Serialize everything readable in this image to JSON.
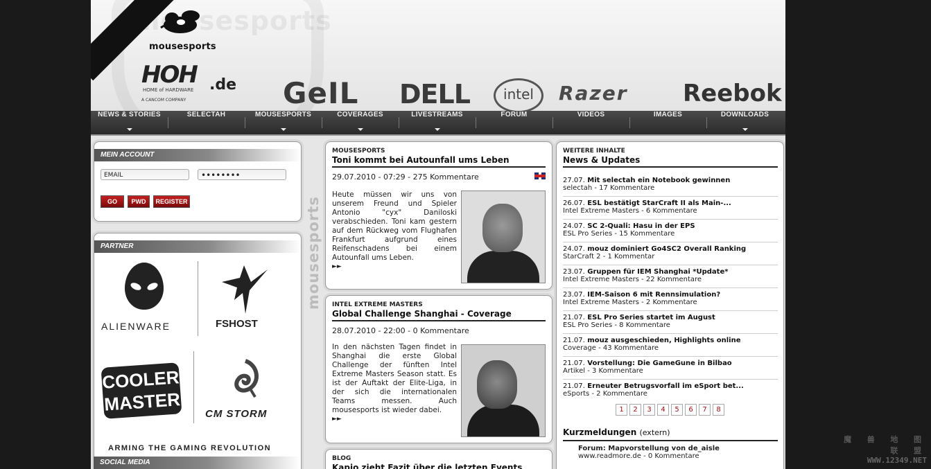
{
  "header": {
    "logo_text": "mousesports",
    "hoh_logo": "HOH",
    "hoh_domain": ".de",
    "hoh_tagline": "HOME of HARDWARE",
    "hoh_company": "A CANCOM COMPANY",
    "sponsors": [
      "GeIL",
      "DELL",
      "intel",
      "Razer",
      "Reebok"
    ]
  },
  "nav": {
    "items": [
      {
        "label": "NEWS & STORIES",
        "has_dropdown": true
      },
      {
        "label": "SELECTAH",
        "has_dropdown": false
      },
      {
        "label": "MOUSESPORTS",
        "has_dropdown": true
      },
      {
        "label": "COVERAGES",
        "has_dropdown": true
      },
      {
        "label": "LIVESTREAMS",
        "has_dropdown": true
      },
      {
        "label": "FORUM",
        "has_dropdown": false
      },
      {
        "label": "VIDEOS",
        "has_dropdown": false
      },
      {
        "label": "IMAGES",
        "has_dropdown": false
      },
      {
        "label": "DOWNLOADS",
        "has_dropdown": true
      }
    ]
  },
  "account": {
    "heading": "MEIN ACCOUNT",
    "email_placeholder": "EMAIL",
    "password_value": "••••••••",
    "buttons": {
      "go": "GO",
      "pwd": "PWD",
      "register": "REGISTER"
    }
  },
  "partner": {
    "heading": "PARTNER",
    "alienware": "ALIENWARE",
    "fshost": "FSHOST",
    "coolermaster_line1": "COOLER",
    "coolermaster_line2": "MASTER",
    "cmstorm": "CM STORM",
    "slogan": "ARMING THE GAMING REVOLUTION"
  },
  "social": {
    "heading": "SOCIAL MEDIA"
  },
  "vertical_brand": "mousesports",
  "articles": [
    {
      "category": "MOUSESPORTS",
      "title": "Toni kommt bei Autounfall ums Leben",
      "meta": "29.07.2010 - 07:29 - 275 Kommentare",
      "body": "Heute müssen wir uns von unserem Freund und Spieler Antonio \"cyx\" Daniloski verabschieden. Toni kam gestern auf dem Rückweg vom Flughafen Frankfurt aufgrund eines Reifenschadens bei einem Autounfall ums Leben.",
      "more": "►►"
    },
    {
      "category": "INTEL EXTREME MASTERS",
      "title": "Global Challenge Shanghai - Coverage",
      "meta": "28.07.2010 - 22:00 - 0 Kommentare",
      "body": "In den nächsten Tagen findet in Shanghai die erste Global Challenge der fünften Intel Extreme Masters Season statt. Es ist der Auftakt der Elite-Liga, in der sich die internationalen Teams messen. Auch mousesports ist wieder dabei.",
      "more": "►►"
    },
    {
      "category": "BLOG",
      "title": "Kapio zieht Fazit über die letzten Events"
    }
  ],
  "right": {
    "category": "WEITERE INHALTE",
    "title": "News & Updates",
    "news": [
      {
        "date": "27.07.",
        "title": "Mit selectah ein Notebook gewinnen",
        "sub": "selectah - 17 Kommentare"
      },
      {
        "date": "26.07.",
        "title": "ESL bestätigt StarCraft II als Main-...",
        "sub": "Intel Extreme Masters - 6 Kommentare"
      },
      {
        "date": "24.07.",
        "title": "SC 2-Quali: Hasu in der EPS",
        "sub": "ESL Pro Series - 15 Kommentare"
      },
      {
        "date": "24.07.",
        "title": "mouz dominiert Go4SC2 Overall Ranking",
        "sub": "StarCraft 2 - 1 Kommentar"
      },
      {
        "date": "23.07.",
        "title": "Gruppen für IEM Shanghai *Update*",
        "sub": "Intel Extreme Masters - 22 Kommentare"
      },
      {
        "date": "23.07.",
        "title": "IEM-Saison 6 mit Rennsimulation?",
        "sub": "Intel Extreme Masters - 2 Kommentare"
      },
      {
        "date": "21.07.",
        "title": "ESL Pro Series startet im August",
        "sub": "ESL Pro Series - 8 Kommentare"
      },
      {
        "date": "21.07.",
        "title": "mouz ausgeschieden, Highlights online",
        "sub": "Coverage - 43 Kommentare"
      },
      {
        "date": "21.07.",
        "title": "Vorstellung: Die GameGune in Bilbao",
        "sub": "Artikel - 3 Kommentare"
      },
      {
        "date": "21.07.",
        "title": "Erneuter Betrugsvorfall im eSport bet...",
        "sub": "eSports - 2 Kommentare"
      }
    ],
    "pages": [
      "1",
      "2",
      "3",
      "4",
      "5",
      "6",
      "7",
      "8"
    ],
    "kurz_title": "Kurzmeldungen",
    "kurz_ext": "(extern)",
    "kurz_items": [
      {
        "title": "Forum: Mapvorstellung von de_aisle",
        "sub": "www.readmore.de - 0 Kommentare"
      }
    ]
  },
  "watermark": {
    "line1": "魔 兽 地 图 联 盟",
    "line2": "WWW.12349.NET"
  }
}
